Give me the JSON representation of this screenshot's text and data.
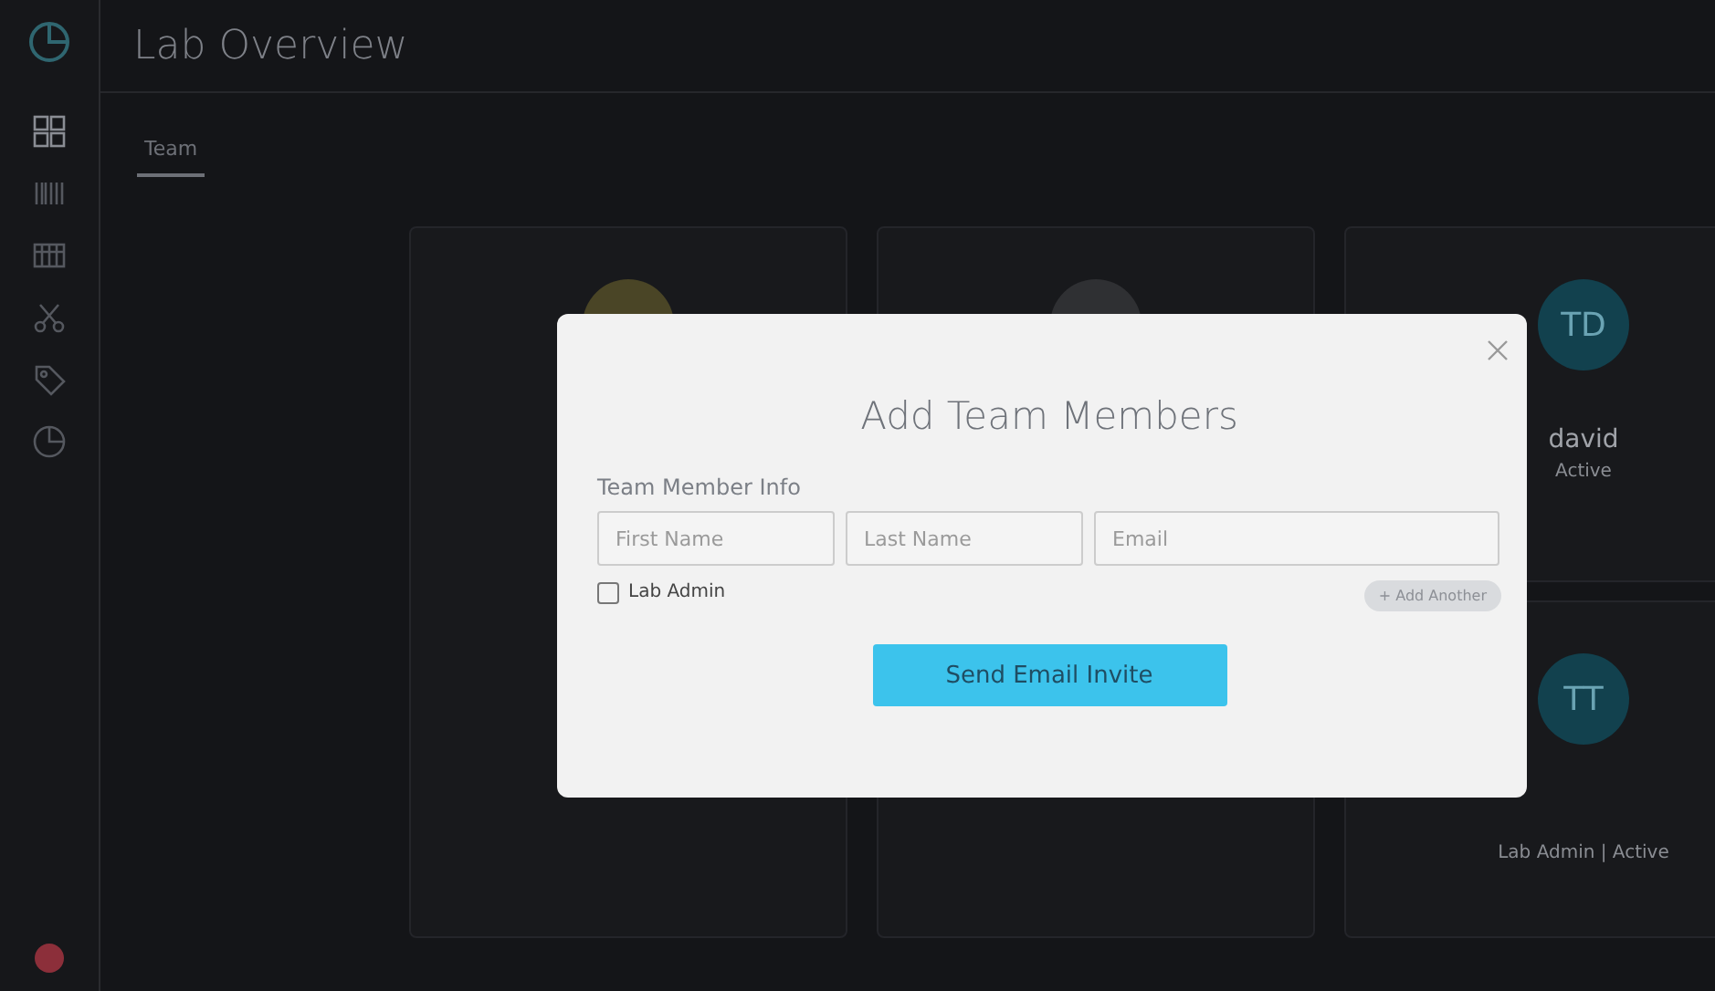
{
  "header": {
    "title": "Lab Overview"
  },
  "sidebar": {
    "items": [
      {
        "kind": "grid",
        "selected": true
      },
      {
        "kind": "barcode",
        "selected": false
      },
      {
        "kind": "table",
        "selected": false
      },
      {
        "kind": "scissors",
        "selected": false
      },
      {
        "kind": "tag",
        "selected": false
      },
      {
        "kind": "chart",
        "selected": false
      }
    ]
  },
  "tabs": [
    {
      "label": "Team",
      "selected": true
    }
  ],
  "cards": [
    {
      "color": "#4a4526"
    },
    {
      "color": "#2f3033"
    },
    {
      "initials": "TD",
      "color": "#12414e",
      "name": "david",
      "detail": "Active"
    },
    {
      "initials": "TT",
      "color": "#12414e",
      "detail": "Lab Admin | Active"
    }
  ],
  "modal": {
    "title": "Add Team Members",
    "section_label": "Team Member Info",
    "fields": [
      {
        "placeholder": "First Name"
      },
      {
        "placeholder": "Last Name"
      },
      {
        "placeholder": "Email"
      }
    ],
    "checkbox": {
      "label": "Lab Admin",
      "checked": false
    },
    "add_another": "+ Add Another",
    "submit": "Send Email Invite"
  }
}
